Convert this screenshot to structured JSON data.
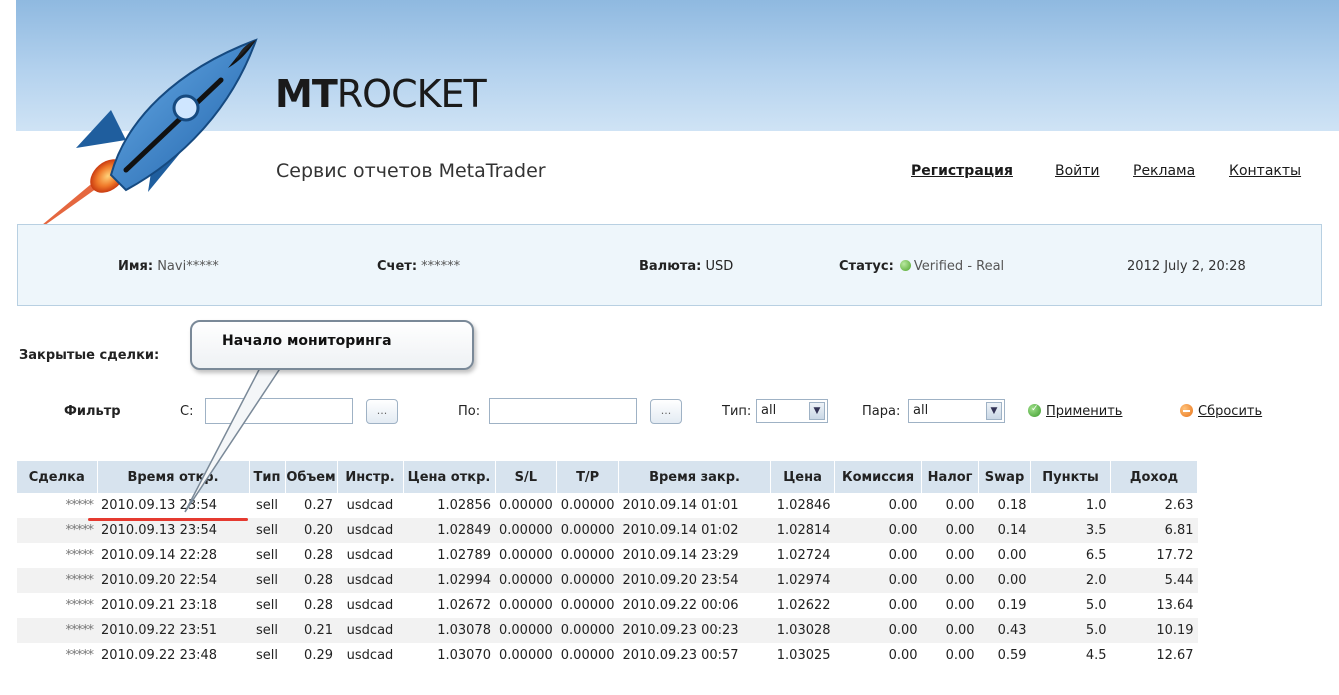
{
  "brand": {
    "logo_bold": "MT",
    "logo_rest": "ROCKET",
    "tagline": "Сервис отчетов MetaTrader"
  },
  "nav": [
    {
      "label": "Регистрация",
      "bold": true
    },
    {
      "label": "Войти"
    },
    {
      "label": "Реклама"
    },
    {
      "label": "Контакты"
    }
  ],
  "account": {
    "name_label": "Имя:",
    "name_value": "Navi*****",
    "account_label": "Счет:",
    "account_value": "******",
    "currency_label": "Валюта:",
    "currency_value": "USD",
    "status_label": "Статус:",
    "status_value": "Verified - Real",
    "datetime": "2012 July 2, 20:28"
  },
  "closed_trades_label": "Закрытые сделки:",
  "callout": "Начало мониторинга",
  "filter": {
    "title": "Фильтр",
    "from_label": "С:",
    "from_value": "",
    "to_label": "По:",
    "to_value": "",
    "browse_label": "...",
    "type_label": "Тип:",
    "type_value": "all",
    "pair_label": "Пара:",
    "pair_value": "all",
    "apply_label": "Применить",
    "reset_label": "Сбросить"
  },
  "table": {
    "headers": [
      "Сделка",
      "Время откр.",
      "Тип",
      "Объем",
      "Инстр.",
      "Цена откр.",
      "S/L",
      "T/P",
      "Время закр.",
      "Цена",
      "Комиссия",
      "Налог",
      "Swap",
      "Пункты",
      "Доход"
    ],
    "rows": [
      [
        "*****",
        "2010.09.13 23:54",
        "sell",
        "0.27",
        "usdcad",
        "1.02856",
        "0.00000",
        "0.00000",
        "2010.09.14 01:01",
        "1.02846",
        "0.00",
        "0.00",
        "0.18",
        "1.0",
        "2.63"
      ],
      [
        "*****",
        "2010.09.13 23:54",
        "sell",
        "0.20",
        "usdcad",
        "1.02849",
        "0.00000",
        "0.00000",
        "2010.09.14 01:02",
        "1.02814",
        "0.00",
        "0.00",
        "0.14",
        "3.5",
        "6.81"
      ],
      [
        "*****",
        "2010.09.14 22:28",
        "sell",
        "0.28",
        "usdcad",
        "1.02789",
        "0.00000",
        "0.00000",
        "2010.09.14 23:29",
        "1.02724",
        "0.00",
        "0.00",
        "0.00",
        "6.5",
        "17.72"
      ],
      [
        "*****",
        "2010.09.20 22:54",
        "sell",
        "0.28",
        "usdcad",
        "1.02994",
        "0.00000",
        "0.00000",
        "2010.09.20 23:54",
        "1.02974",
        "0.00",
        "0.00",
        "0.00",
        "2.0",
        "5.44"
      ],
      [
        "*****",
        "2010.09.21 23:18",
        "sell",
        "0.28",
        "usdcad",
        "1.02672",
        "0.00000",
        "0.00000",
        "2010.09.22 00:06",
        "1.02622",
        "0.00",
        "0.00",
        "0.19",
        "5.0",
        "13.64"
      ],
      [
        "*****",
        "2010.09.22 23:51",
        "sell",
        "0.21",
        "usdcad",
        "1.03078",
        "0.00000",
        "0.00000",
        "2010.09.23 00:23",
        "1.03028",
        "0.00",
        "0.00",
        "0.43",
        "5.0",
        "10.19"
      ],
      [
        "*****",
        "2010.09.22 23:48",
        "sell",
        "0.29",
        "usdcad",
        "1.03070",
        "0.00000",
        "0.00000",
        "2010.09.23 00:57",
        "1.03025",
        "0.00",
        "0.00",
        "0.59",
        "4.5",
        "12.67"
      ]
    ]
  }
}
